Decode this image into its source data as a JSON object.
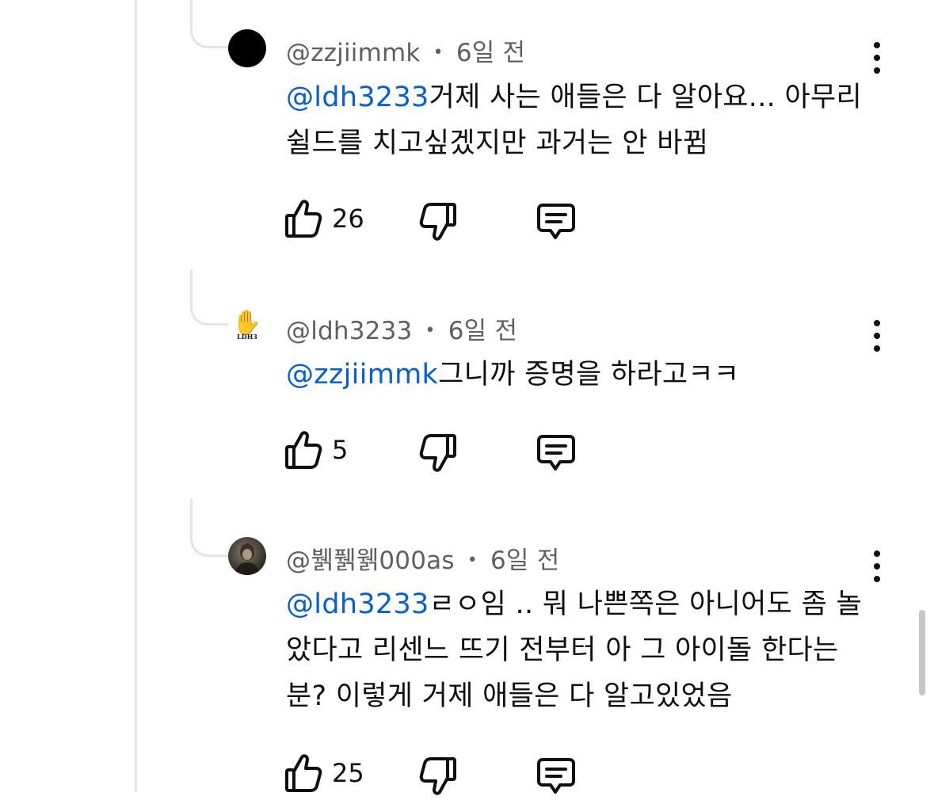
{
  "comments": [
    {
      "author": "@zzjiimmk",
      "time": "6일 전",
      "mention": "@ldh3233",
      "text": "거제 사는 애들은 다 알아요... 아무리 쉴드를 치고싶겠지만 과거는 안 바뀜",
      "likes": "26",
      "avatar": "black-circle"
    },
    {
      "author": "@ldh3233",
      "time": "6일 전",
      "mention": "@zzjiimmk",
      "text": "그니까 증명을 하라고ㅋㅋ",
      "likes": "5",
      "avatar": "hand-print",
      "avatar_text": "LDH3"
    },
    {
      "author": "@뷁풹웱000as",
      "time": "6일 전",
      "mention": "@ldh3233",
      "text": "ㄹㅇ임 .. 뭐 나쁜쪽은 아니어도 좀 놀았다고 리센느 뜨기 전부터 아 그 아이돌 한다는분? 이렇게 거제 애들은 다 알고있었음",
      "likes": "25",
      "avatar": "photo"
    }
  ],
  "separator": "•",
  "icons": {
    "like": "thumbs-up-icon",
    "dislike": "thumbs-down-icon",
    "reply": "comment-reply-icon",
    "more": "more-vertical-icon"
  },
  "colors": {
    "mention": "#065fd4",
    "meta": "#606060",
    "text": "#0f0f0f",
    "thread_line": "#e5e5e5"
  }
}
